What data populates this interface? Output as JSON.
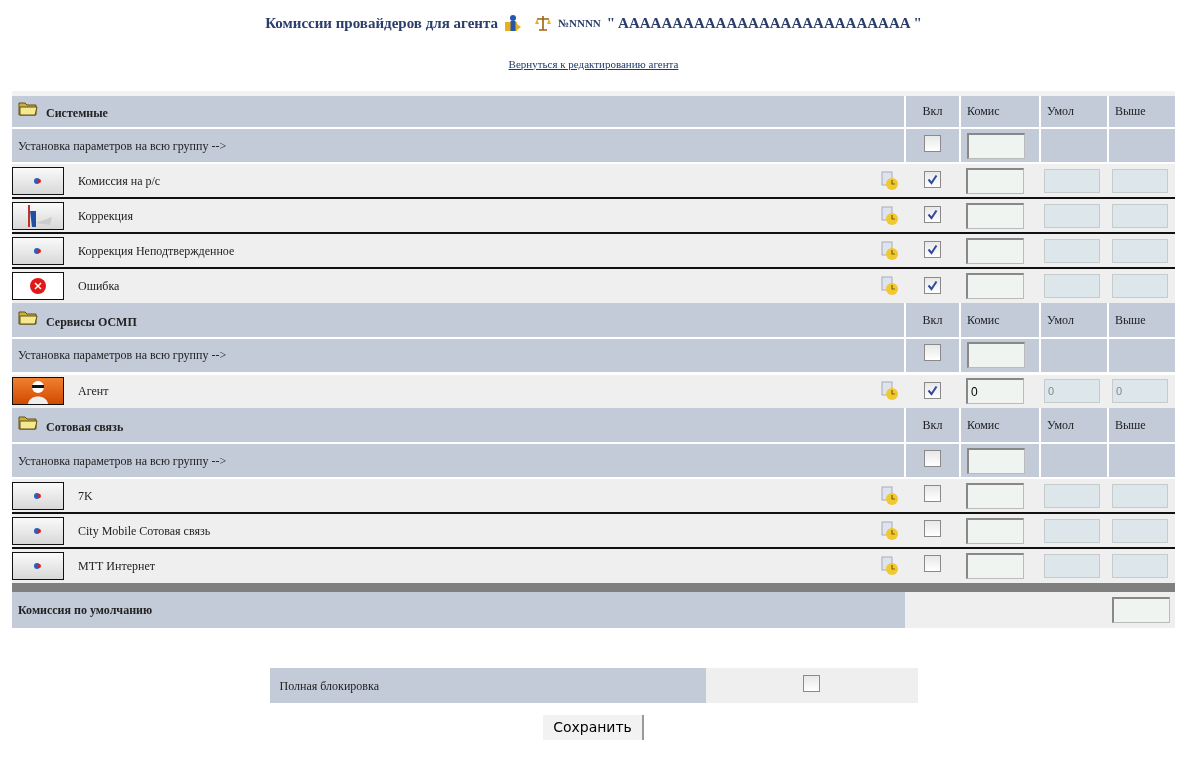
{
  "title": {
    "text": "Комиссии провайдеров для агента",
    "number": "№NNNN",
    "name": "\" AAAAAAAAAAAAAAAAAAAAAAAAAAA \""
  },
  "back_link": "Вернуться к редактированию агента",
  "groups": [
    {
      "name": "Системные",
      "columns": [
        "Вкл",
        "Комис",
        "Умол",
        "Выше"
      ],
      "set_all": {
        "label": "Установка параметров на всю группу -->",
        "checked": false
      },
      "items": [
        {
          "name": "Комиссия на р/с",
          "kind": "emblem",
          "checked": true
        },
        {
          "name": "Коррекция",
          "kind": "figure",
          "checked": true
        },
        {
          "name": "Коррекция Неподтвержденное",
          "kind": "emblem",
          "checked": true
        },
        {
          "name": "Ошибка",
          "kind": "error",
          "checked": true
        }
      ]
    },
    {
      "name": "Сервисы ОСМП",
      "columns": [
        "Вкл",
        "Комис",
        "Умол",
        "Выше"
      ],
      "set_all": {
        "label": "Установка параметров на всю группу -->",
        "checked": false
      },
      "items": [
        {
          "name": "Агент",
          "kind": "agent",
          "checked": true,
          "commission": "0",
          "default": "0",
          "above": "0"
        }
      ]
    },
    {
      "name": "Сотовая связь",
      "columns": [
        "Вкл",
        "Комис",
        "Умол",
        "Выше"
      ],
      "set_all": {
        "label": "Установка параметров на всю группу -->",
        "checked": false
      },
      "items": [
        {
          "name": "7K",
          "kind": "emblem",
          "checked": false
        },
        {
          "name": "City Mobile Сотовая связь",
          "kind": "emblem",
          "checked": false
        },
        {
          "name": "МТТ Интернет",
          "kind": "emblem",
          "checked": false
        }
      ]
    }
  ],
  "default_commission": {
    "label": "Комиссия по умолчанию"
  },
  "full_block": {
    "label": "Полная блокировка",
    "checked": false
  },
  "save_button": "Сохранить"
}
